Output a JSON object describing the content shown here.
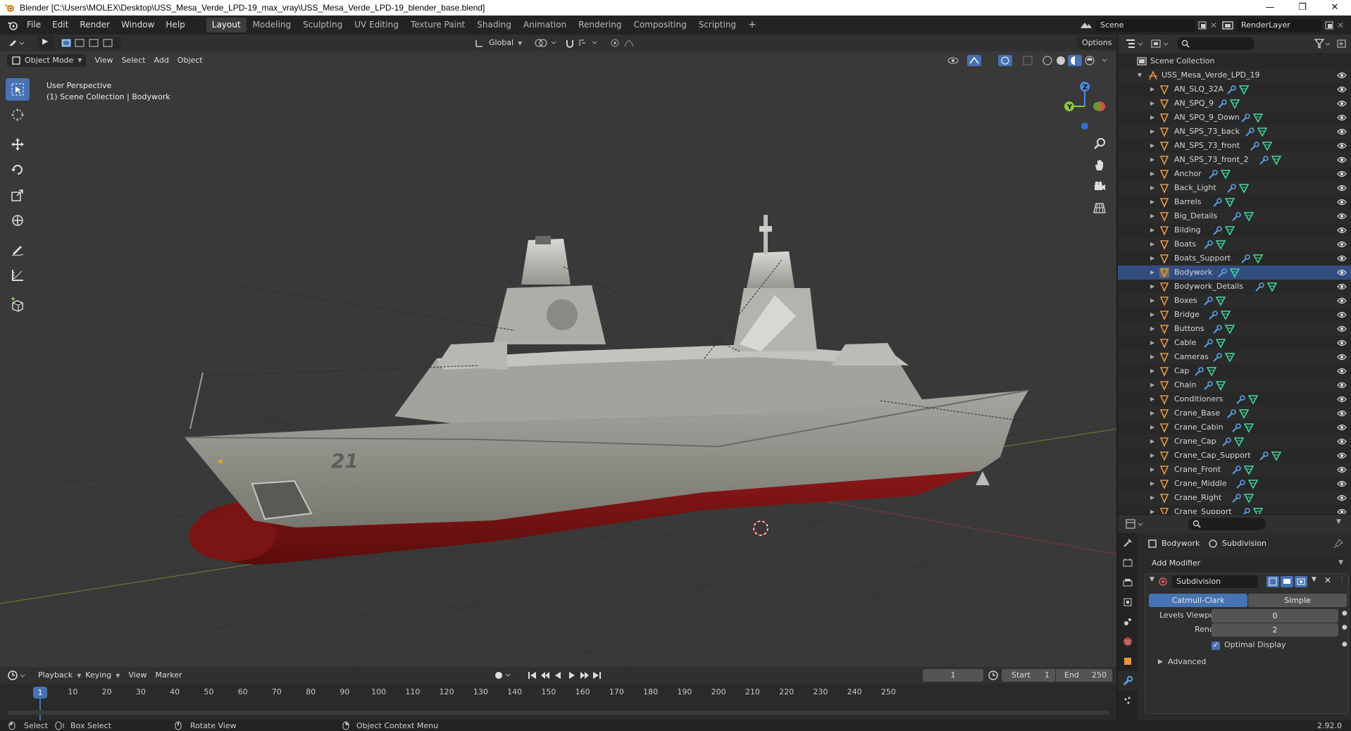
{
  "titlebar": {
    "title": "Blender [C:\\Users\\MOLEX\\Desktop\\USS_Mesa_Verde_LPD-19_max_vray\\USS_Mesa_Verde_LPD-19_blender_base.blend]",
    "min": "—",
    "max": "❐",
    "close": "✕"
  },
  "menubar": {
    "menus": [
      "File",
      "Edit",
      "Render",
      "Window",
      "Help"
    ],
    "workspaces": [
      "Layout",
      "Modeling",
      "Sculpting",
      "UV Editing",
      "Texture Paint",
      "Shading",
      "Animation",
      "Rendering",
      "Compositing",
      "Scripting"
    ],
    "active_workspace": "Layout",
    "add_tab": "+",
    "scene": "Scene",
    "view_layer": "RenderLayer"
  },
  "viewport": {
    "orientation": "Global",
    "options": "Options",
    "mode": "Object Mode",
    "menus": [
      "View",
      "Select",
      "Add",
      "Object"
    ],
    "perspective": "User Perspective",
    "collection_info": "(1) Scene Collection | Bodywork",
    "hull_number": "21",
    "gizmo": {
      "x": "X",
      "y": "Y",
      "z": "Z"
    }
  },
  "outliner": {
    "root": "Scene Collection",
    "collection": "USS_Mesa_Verde_LPD_19",
    "selected": "Bodywork",
    "objects": [
      "AN_SLQ_32A",
      "AN_SPQ_9",
      "AN_SPQ_9_Down",
      "AN_SPS_73_back",
      "AN_SPS_73_front",
      "AN_SPS_73_front_2",
      "Anchor",
      "Back_Light",
      "Barrels",
      "Big_Details",
      "Bilding",
      "Boats",
      "Boats_Support",
      "Bodywork",
      "Bodywork_Details",
      "Boxes",
      "Bridge",
      "Buttons",
      "Cable",
      "Cameras",
      "Cap",
      "Chain",
      "Conditioners",
      "Crane_Base",
      "Crane_Cabin",
      "Crane_Cap",
      "Crane_Cap_Support",
      "Crane_Front",
      "Crane_Middle",
      "Crane_Right",
      "Crane_Support"
    ]
  },
  "properties": {
    "object": "Bodywork",
    "modifier_crumb": "Subdivision",
    "add_modifier": "Add Modifier",
    "modifier_name": "Subdivision",
    "mode_catmull": "Catmull-Clark",
    "mode_simple": "Simple",
    "levels_viewport_label": "Levels Viewport",
    "levels_viewport": "0",
    "render_label": "Render",
    "render_value": "2",
    "optimal_display": "Optimal Display",
    "advanced": "Advanced"
  },
  "timeline": {
    "menus": [
      "Playback",
      "Keying",
      "View",
      "Marker"
    ],
    "current_frame": "1",
    "start_label": "Start",
    "start": "1",
    "end_label": "End",
    "end": "250",
    "ticks": [
      "1",
      "10",
      "20",
      "30",
      "40",
      "50",
      "60",
      "70",
      "80",
      "90",
      "100",
      "110",
      "120",
      "130",
      "140",
      "150",
      "160",
      "170",
      "180",
      "190",
      "200",
      "210",
      "220",
      "230",
      "240",
      "250"
    ],
    "playhead": "1"
  },
  "statusbar": {
    "select": "Select",
    "box_select": "Box Select",
    "rotate_view": "Rotate View",
    "context_menu": "Object Context Menu",
    "version": "2.92.0"
  },
  "colors": {
    "accent": "#4772b3",
    "selected_row": "#334d80",
    "hull_red": "#7a1414",
    "hull_grey": "#8e8e88",
    "x_axis": "#e24a4a",
    "y_axis": "#8cc63f",
    "z_axis": "#4a8ae2"
  }
}
